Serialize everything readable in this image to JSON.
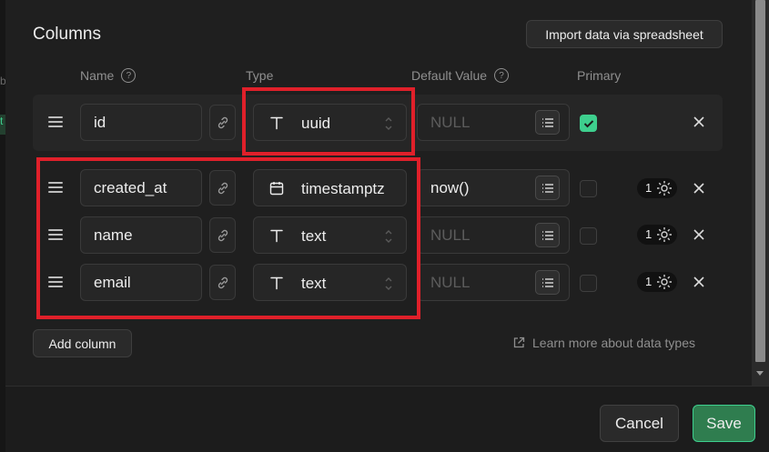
{
  "section_title": "Columns",
  "import_button": "Import data via spreadsheet",
  "headers": {
    "name": "Name",
    "type": "Type",
    "default_value": "Default Value",
    "primary": "Primary"
  },
  "help_glyph": "?",
  "rows": [
    {
      "name": "id",
      "type": "uuid",
      "type_icon": "text-type-icon",
      "default": "NULL",
      "default_is_placeholder": true,
      "primary": true,
      "badge": ""
    },
    {
      "name": "created_at",
      "type": "timestamptz",
      "type_icon": "calendar-icon",
      "default": "now()",
      "default_is_placeholder": false,
      "primary": false,
      "badge": "1"
    },
    {
      "name": "name",
      "type": "text",
      "type_icon": "text-type-icon",
      "default": "NULL",
      "default_is_placeholder": true,
      "primary": false,
      "badge": "1"
    },
    {
      "name": "email",
      "type": "text",
      "type_icon": "text-type-icon",
      "default": "NULL",
      "default_is_placeholder": true,
      "primary": false,
      "badge": "1"
    }
  ],
  "add_column_button": "Add column",
  "learn_more_link": "Learn more about data types",
  "footer": {
    "cancel": "Cancel",
    "save": "Save"
  },
  "left_fragments": [
    "b",
    "t"
  ],
  "colors": {
    "accent_green": "#3ecf8e",
    "highlight_red": "#e0202a",
    "background": "#1c1c1c"
  }
}
